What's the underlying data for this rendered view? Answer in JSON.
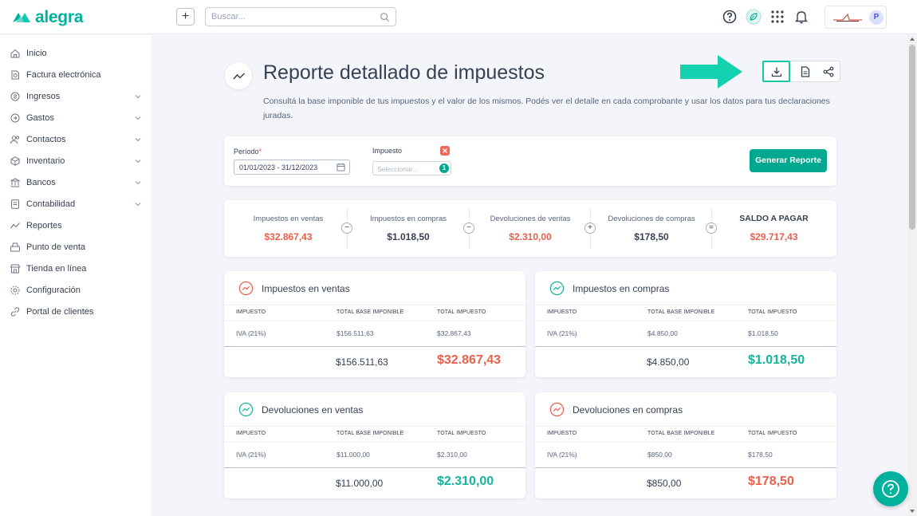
{
  "brand": {
    "name": "alegra",
    "accent": "#00b19d"
  },
  "topbar": {
    "search_placeholder": "Buscar...",
    "icons": [
      "plus-icon",
      "search-icon",
      "help-circle-icon",
      "leaf-icon",
      "apps-grid-icon",
      "bell-icon"
    ],
    "avatar_initial": "P"
  },
  "sidebar": {
    "items": [
      {
        "label": "Inicio",
        "icon": "home-icon",
        "expandable": false
      },
      {
        "label": "Factura electrónica",
        "icon": "invoice-icon",
        "expandable": false
      },
      {
        "label": "Ingresos",
        "icon": "income-icon",
        "expandable": true
      },
      {
        "label": "Gastos",
        "icon": "expense-icon",
        "expandable": true
      },
      {
        "label": "Contactos",
        "icon": "contacts-icon",
        "expandable": true
      },
      {
        "label": "Inventario",
        "icon": "inventory-icon",
        "expandable": true
      },
      {
        "label": "Bancos",
        "icon": "bank-icon",
        "expandable": true
      },
      {
        "label": "Contabilidad",
        "icon": "accounting-icon",
        "expandable": true
      },
      {
        "label": "Reportes",
        "icon": "reports-icon",
        "expandable": false
      },
      {
        "label": "Punto de venta",
        "icon": "pos-icon",
        "expandable": false
      },
      {
        "label": "Tienda en línea",
        "icon": "store-icon",
        "expandable": false
      },
      {
        "label": "Configuración",
        "icon": "settings-icon",
        "expandable": false
      },
      {
        "label": "Portal de clientes",
        "icon": "link-icon",
        "expandable": false
      }
    ]
  },
  "header": {
    "title": "Reporte detallado de impuestos",
    "description": "Consultá la base imponible de tus impuestos y el valor de los mismos. Podés ver el detalle en cada comprobante y usar los datos para tus declaraciones juradas.",
    "actions": [
      "download-icon",
      "document-icon",
      "share-icon"
    ]
  },
  "filters": {
    "period_label": "Período",
    "period_required": "*",
    "period_value": "01/01/2023 - 31/12/2023",
    "tax_label": "Impuesto",
    "tax_placeholder": "Seleccionar...",
    "tax_selected_count": "1",
    "generate_button": "Generar Reporte"
  },
  "summary": {
    "items": [
      {
        "label": "Impuestos en ventas",
        "value": "$32.867,43"
      },
      {
        "label": "Impuestos en compras",
        "value": "$1.018,50"
      },
      {
        "label": "Devoluciones de ventas",
        "value": "$2.310,00"
      },
      {
        "label": "Devoluciones de compras",
        "value": "$178,50"
      },
      {
        "label": "SALDO A PAGAR",
        "value": "$29.717,43"
      }
    ],
    "operators": [
      "−",
      "−",
      "+",
      "="
    ]
  },
  "columns": {
    "tax": "IMPUESTO",
    "base": "TOTAL BASE IMPONIBLE",
    "total": "TOTAL IMPUESTO"
  },
  "cards": [
    {
      "title": "Impuestos en ventas",
      "trend": "up-red",
      "row": {
        "tax": "IVA (21%)",
        "base": "$156.511,63",
        "total": "$32.867,43"
      },
      "base_total": "$156.511,63",
      "tax_total": "$32.867,43"
    },
    {
      "title": "Impuestos en compras",
      "trend": "up-teal",
      "row": {
        "tax": "IVA (21%)",
        "base": "$4.850,00",
        "total": "$1.018,50"
      },
      "base_total": "$4.850,00",
      "tax_total": "$1.018,50"
    },
    {
      "title": "Devoluciones en ventas",
      "trend": "up-teal",
      "row": {
        "tax": "IVA (21%)",
        "base": "$11.000,00",
        "total": "$2.310,00"
      },
      "base_total": "$11.000,00",
      "tax_total": "$2.310,00"
    },
    {
      "title": "Devoluciones en compras",
      "trend": "up-red",
      "row": {
        "tax": "IVA (21%)",
        "base": "$850,00",
        "total": "$178,50"
      },
      "base_total": "$850,00",
      "tax_total": "$178,50"
    }
  ],
  "colors": {
    "red": "#e8604c",
    "teal": "#17b39c",
    "primary_button": "#00a88f"
  }
}
